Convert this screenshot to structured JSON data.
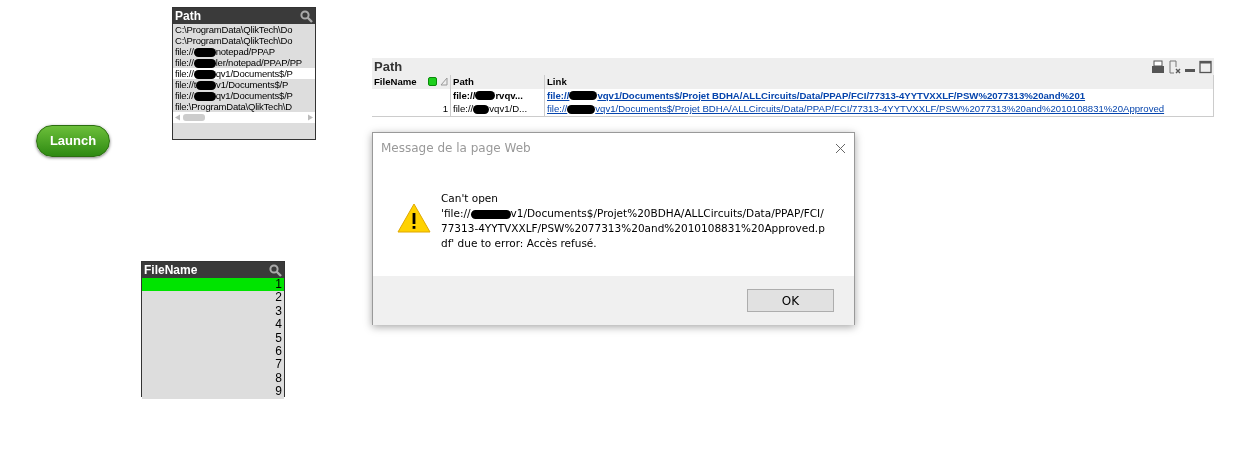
{
  "launch_button": {
    "label": "Launch"
  },
  "path_listbox": {
    "title": "Path",
    "items": [
      {
        "before": "C:\\ProgramData\\QlikTech\\Do",
        "redacted": false,
        "excluded": true
      },
      {
        "before": "C:\\ProgramData\\QlikTech\\Do",
        "redacted": false,
        "excluded": true
      },
      {
        "before": "file://",
        "redacted": true,
        "after": "notepad/PPAP",
        "excluded": true
      },
      {
        "before": "file://",
        "redacted": true,
        "after": "ler/notepad/PPAP/PP",
        "excluded": true
      },
      {
        "before": "file://",
        "redacted": true,
        "after": "qv1/Documents$/P",
        "excluded": false
      },
      {
        "before": "file://t",
        "redacted": true,
        "after": "v1/Documents$/P",
        "excluded": true
      },
      {
        "before": "file://",
        "redacted": true,
        "after": "qv1/Documents$/P",
        "excluded": true
      },
      {
        "before": "file:\\ProgramData\\QlikTech\\D",
        "redacted": false,
        "excluded": true
      }
    ]
  },
  "filename_listbox": {
    "title": "FileName",
    "items": [
      {
        "label": "1",
        "selected": true
      },
      {
        "label": "2",
        "selected": false
      },
      {
        "label": "3",
        "selected": false
      },
      {
        "label": "4",
        "selected": false
      },
      {
        "label": "5",
        "selected": false
      },
      {
        "label": "6",
        "selected": false
      },
      {
        "label": "7",
        "selected": false
      },
      {
        "label": "8",
        "selected": false
      },
      {
        "label": "9",
        "selected": false
      }
    ]
  },
  "table": {
    "caption": "Path",
    "columns": [
      {
        "label": "FileName",
        "has_selection": true,
        "sorted": true
      },
      {
        "label": "Path",
        "has_selection": false,
        "sorted": false
      },
      {
        "label": "Link",
        "has_selection": false,
        "sorted": false
      }
    ],
    "total_row": {
      "path": {
        "before": "file://",
        "redacted": true,
        "after": "rvqv..."
      },
      "link": {
        "before": "file://",
        "redacted": true,
        "after": "vqv1/Documents$/Projet BDHA/ALLCircuits/Data/PPAP/FCI/77313-4YYTVXXLF/PSW%2077313%20and%201"
      }
    },
    "rows": [
      {
        "filename": "1",
        "path": {
          "before": "file://",
          "redacted": true,
          "after": "vqv1/D..."
        },
        "link": {
          "before": "file://",
          "redacted": true,
          "after": "vqv1/Documents$/Projet BDHA/ALLCircuits/Data/PPAP/FCI/77313-4YYTVXXLF/PSW%2077313%20and%2010108831%20Approved"
        }
      }
    ]
  },
  "dialog": {
    "title": "Message de la page Web",
    "first_line": "Can't open",
    "before": "'file://",
    "redacted": true,
    "after": "v1/Documents$/Projet%20BDHA/ALLCircuits/Data/PPAP/FCI/77313-4YYTVXXLF/PSW%2077313%20and%2010108831%20Approved.pdf' due to error: Accès refusé.",
    "button": "OK"
  }
}
